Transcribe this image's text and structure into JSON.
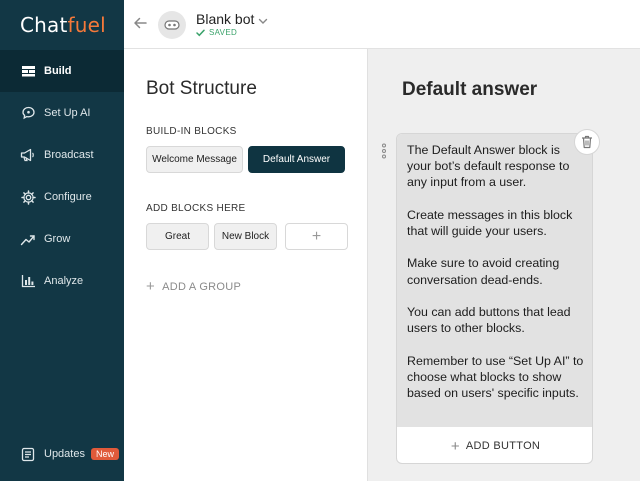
{
  "logo": {
    "part1": "Chat",
    "part2": "fuel"
  },
  "colors": {
    "sidebar": "#123745",
    "accent": "#f5793a",
    "primary_block": "#0f3441",
    "saved": "#3aa26a",
    "new_badge": "#e05a3a"
  },
  "nav": {
    "items": [
      {
        "label": "Build",
        "icon": "build-icon",
        "active": true
      },
      {
        "label": "Set Up AI",
        "icon": "ai-brain-icon"
      },
      {
        "label": "Broadcast",
        "icon": "megaphone-icon"
      },
      {
        "label": "Configure",
        "icon": "gear-icon"
      },
      {
        "label": "Grow",
        "icon": "growth-chart-icon"
      },
      {
        "label": "Analyze",
        "icon": "bar-chart-icon"
      }
    ],
    "updates": {
      "label": "Updates",
      "badge": "New",
      "icon": "updates-icon"
    }
  },
  "topbar": {
    "bot_name": "Blank bot",
    "status": "SAVED"
  },
  "structure": {
    "title": "Bot Structure",
    "builtin_label": "BUILD-IN BLOCKS",
    "builtin_blocks": [
      "Welcome Message",
      "Default Answer"
    ],
    "add_label": "ADD BLOCKS HERE",
    "user_blocks": [
      "Great",
      "New Block"
    ],
    "add_block": "+",
    "add_group": "ADD A GROUP"
  },
  "editor": {
    "title": "Default answer",
    "paragraphs": [
      "The Default Answer block is your bot’s default response to any input from a user.",
      "Create messages in this block that will guide your users.",
      "Make sure to avoid creating conversation dead-ends.",
      "You can add buttons that lead users to other blocks.",
      "Remember to use “Set Up AI” to choose what blocks to show based on users' specific inputs."
    ],
    "add_button": "ADD BUTTON"
  }
}
